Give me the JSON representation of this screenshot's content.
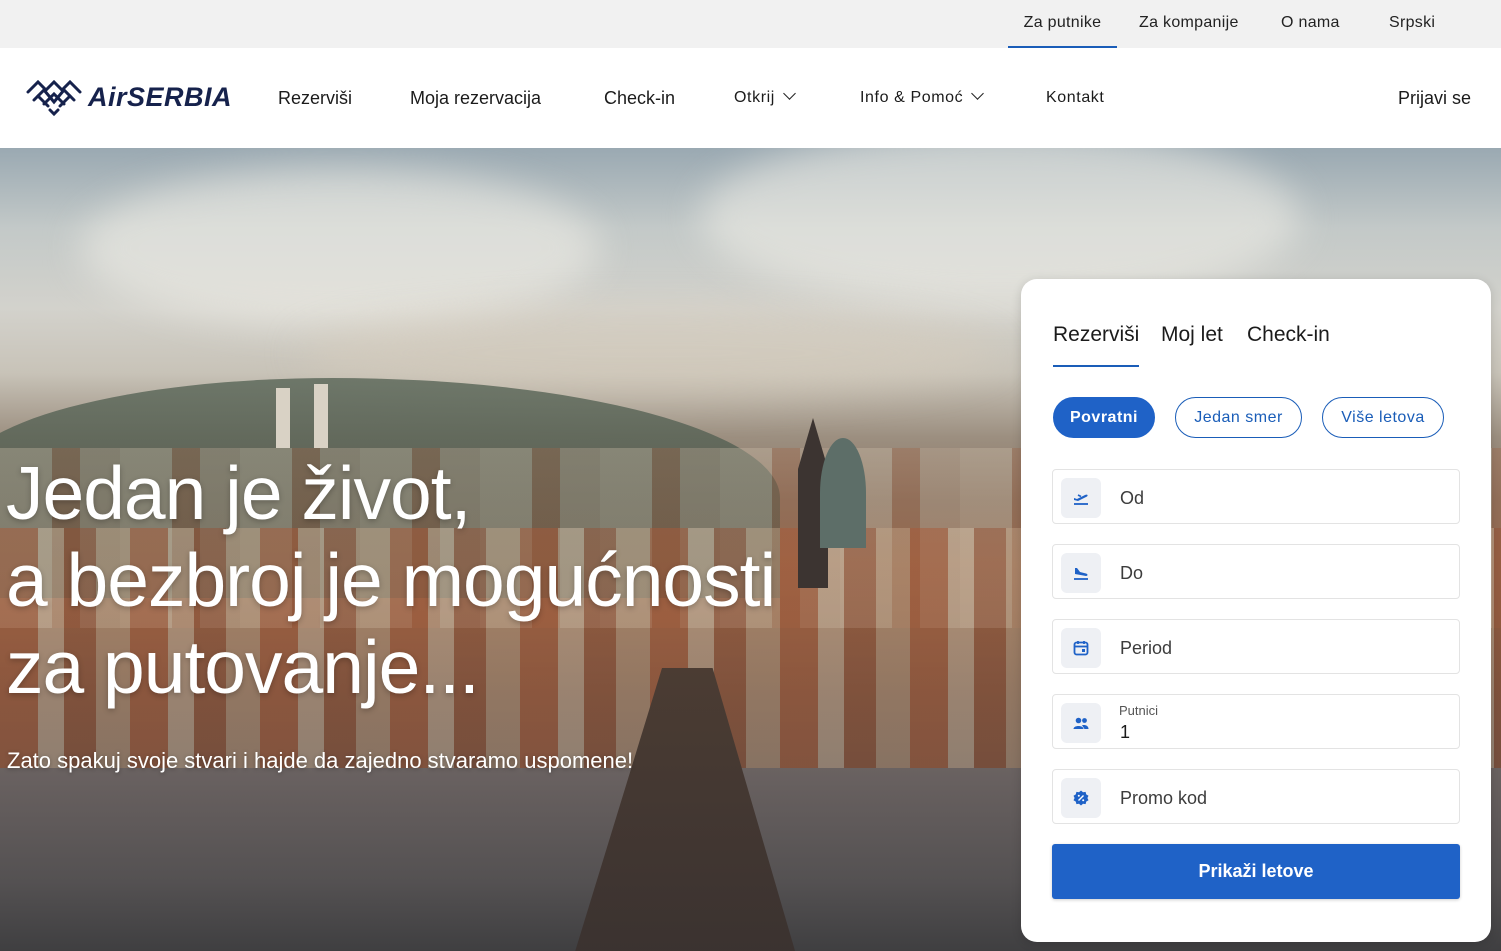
{
  "topbar": {
    "items": [
      {
        "label": "Za putnike",
        "active": true
      },
      {
        "label": "Za kompanije",
        "active": false
      },
      {
        "label": "O nama",
        "active": false
      },
      {
        "label": "Srpski",
        "active": false
      }
    ]
  },
  "navbar": {
    "logo_text": "AirSERBIA",
    "items": [
      {
        "label": "Rezerviši"
      },
      {
        "label": "Moja rezervacija"
      },
      {
        "label": "Check-in"
      },
      {
        "label": "Otkrij",
        "dropdown": true
      },
      {
        "label": "Info & Pomoć",
        "dropdown": true
      },
      {
        "label": "Kontakt"
      }
    ],
    "login_label": "Prijavi se"
  },
  "hero": {
    "headline_lines": [
      "Jedan je život,",
      "a bezbroj je mogućnosti",
      "za putovanje..."
    ],
    "subheadline": "Zato spakuj svoje stvari i hajde da zajedno stvaramo uspomene!"
  },
  "booking": {
    "tabs": [
      {
        "label": "Rezerviši",
        "active": true
      },
      {
        "label": "Moj let",
        "active": false
      },
      {
        "label": "Check-in",
        "active": false
      }
    ],
    "trip_types": [
      {
        "label": "Povratni",
        "active": true
      },
      {
        "label": "Jedan smer",
        "active": false
      },
      {
        "label": "Više letova",
        "active": false
      }
    ],
    "fields": {
      "from": {
        "placeholder": "Od",
        "icon": "takeoff-icon"
      },
      "to": {
        "placeholder": "Do",
        "icon": "landing-icon"
      },
      "period": {
        "placeholder": "Period",
        "icon": "calendar-icon"
      },
      "passengers": {
        "label": "Putnici",
        "value": "1",
        "icon": "people-icon"
      },
      "promo": {
        "placeholder": "Promo kod",
        "icon": "badge-icon"
      }
    },
    "submit_label": "Prikaži letove"
  },
  "colors": {
    "accent": "#1f62c7",
    "brand_navy": "#16224c",
    "topbar_bg": "#f1f1f1"
  }
}
